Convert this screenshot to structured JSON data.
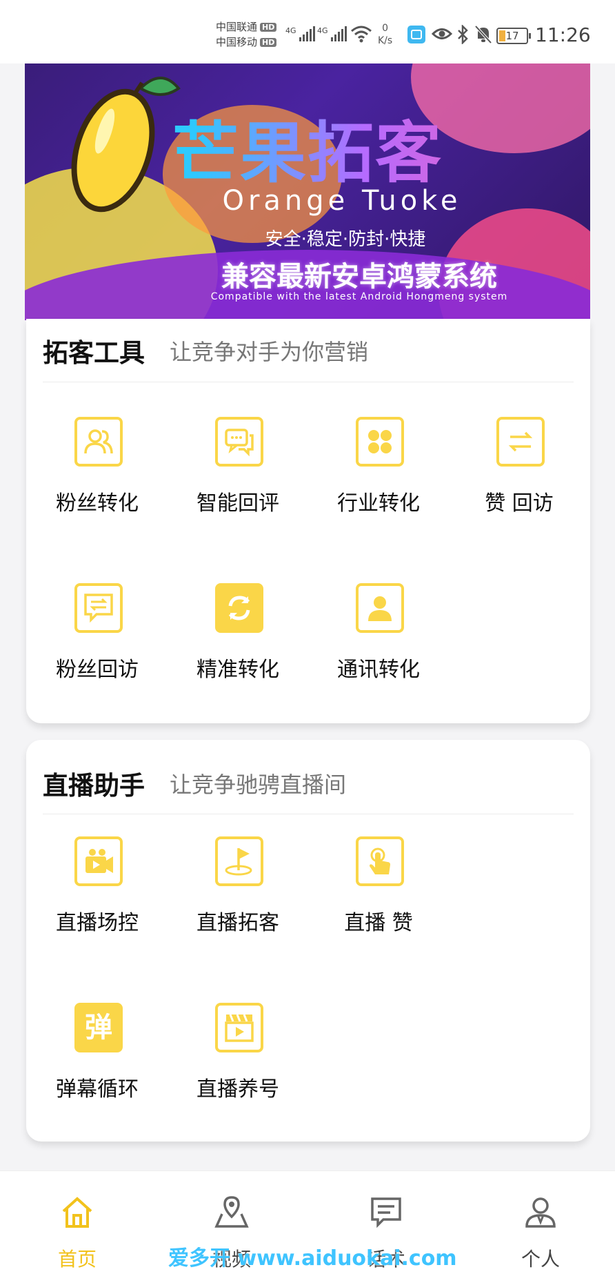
{
  "status_bar": {
    "carrier1": "中国联通",
    "carrier2": "中国移动",
    "hd": "HD",
    "net1": "4G",
    "net2": "4G",
    "speed_value": "0",
    "speed_unit": "K/s",
    "battery": "17",
    "time": "11:26"
  },
  "banner": {
    "title": "芒果拓客",
    "subtitle": "Orange Tuoke",
    "tagline": "安全·稳定·防封·快捷",
    "compat": "兼容最新安卓鸿蒙系统",
    "compat_en": "Compatible with the latest Android Hongmeng system"
  },
  "tools": {
    "title": "拓客工具",
    "subtitle": "让竞争对手为你营销",
    "items": [
      {
        "label": "粉丝转化",
        "icon": "users-icon"
      },
      {
        "label": "智能回评",
        "icon": "chat-bubbles-icon"
      },
      {
        "label": "行业转化",
        "icon": "grid-dots-icon"
      },
      {
        "label": "赞 回访",
        "icon": "swap-arrows-icon"
      },
      {
        "label": "粉丝回访",
        "icon": "message-swap-icon"
      },
      {
        "label": "精准转化",
        "icon": "refresh-icon"
      },
      {
        "label": "通讯转化",
        "icon": "contact-icon"
      }
    ]
  },
  "live": {
    "title": "直播助手",
    "subtitle": "让竞争驰骋直播间",
    "items": [
      {
        "label": "直播场控",
        "icon": "video-camera-icon"
      },
      {
        "label": "直播拓客",
        "icon": "golf-flag-icon"
      },
      {
        "label": "直播 赞",
        "icon": "tap-hand-icon"
      },
      {
        "label": "弹幕循环",
        "icon": "danmu-icon",
        "glyph": "弹"
      },
      {
        "label": "直播养号",
        "icon": "clapperboard-icon"
      }
    ]
  },
  "nav": {
    "items": [
      {
        "label": "首页",
        "icon": "home-icon"
      },
      {
        "label": "视频",
        "icon": "map-pin-icon"
      },
      {
        "label": "话术",
        "icon": "message-icon"
      },
      {
        "label": "个人",
        "icon": "person-icon"
      }
    ]
  },
  "watermark": "爱多开 www.aiduokai.com",
  "colors": {
    "accent": "#fad648",
    "active_nav": "#f2c21c",
    "watermark": "#3fc4ff"
  }
}
